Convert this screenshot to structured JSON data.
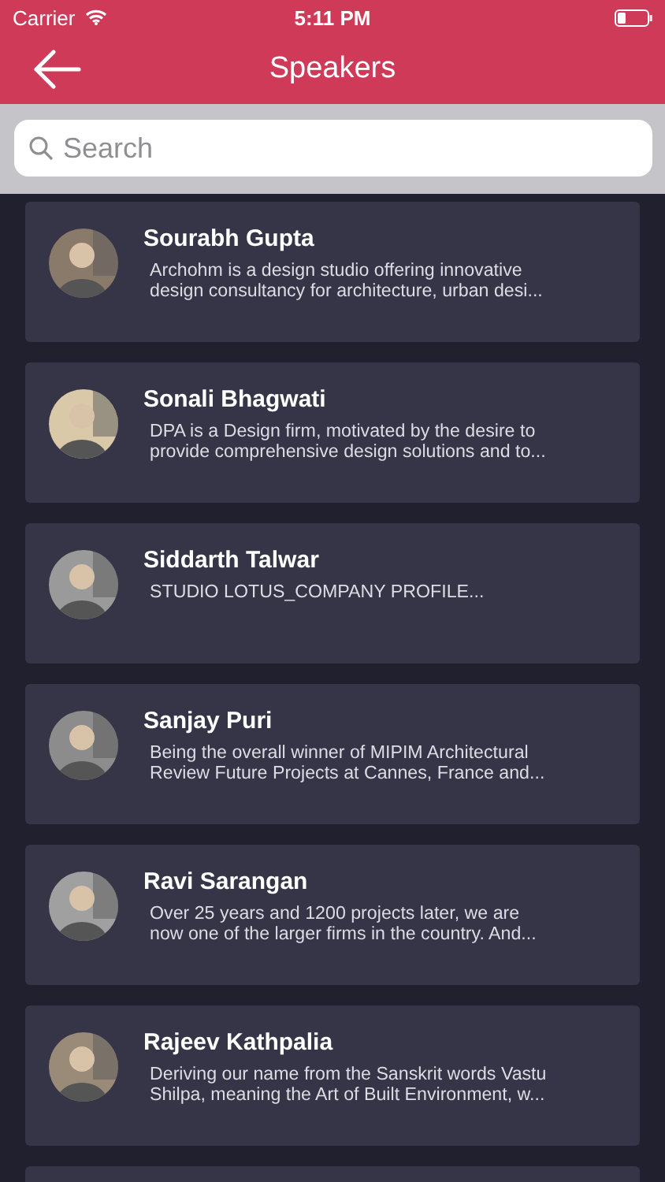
{
  "status_bar": {
    "carrier": "Carrier",
    "time": "5:11 PM"
  },
  "nav": {
    "title": "Speakers"
  },
  "search": {
    "placeholder": "Search"
  },
  "speakers": [
    {
      "name": "Sourabh Gupta",
      "description": [
        "Archohm is a design studio offering innovative",
        "design consultancy for architecture, urban desi..."
      ]
    },
    {
      "name": "Sonali Bhagwati",
      "description": [
        "DPA is a Design firm, motivated by the desire to",
        "provide comprehensive design solutions and to..."
      ]
    },
    {
      "name": "Siddarth Talwar",
      "description": [
        "STUDIO LOTUS_COMPANY PROFILE..."
      ]
    },
    {
      "name": "Sanjay Puri",
      "description": [
        "Being the overall winner of MIPIM Architectural",
        "Review Future Projects at Cannes, France and..."
      ]
    },
    {
      "name": "Ravi Sarangan",
      "description": [
        "Over 25 years and 1200 projects later, we are",
        "now one of the larger firms in the country. And..."
      ]
    },
    {
      "name": "Rajeev Kathpalia",
      "description": [
        "Deriving our name from the Sanskrit words Vastu",
        "Shilpa, meaning the Art of Built Environment, w..."
      ]
    }
  ]
}
